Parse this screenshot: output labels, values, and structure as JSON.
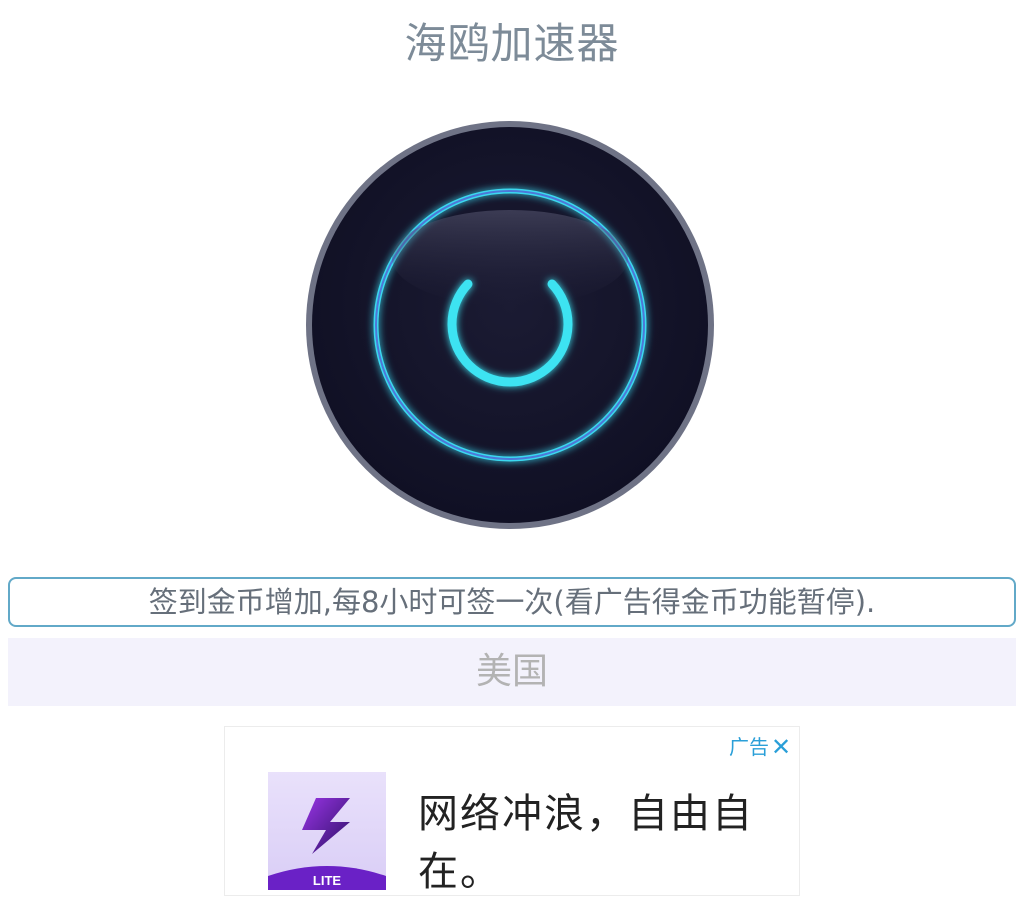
{
  "app": {
    "title": "海鸥加速器"
  },
  "power_button": {
    "icon": "power-icon",
    "state": "off",
    "colors": {
      "face": "#141428",
      "rim": "#6f7386",
      "glow": "#3ee3f2"
    }
  },
  "notice": {
    "text": "签到金币增加,每8小时可签一次(看广告得金币功能暂停)."
  },
  "region": {
    "selected": "美国"
  },
  "ad": {
    "label": "广告",
    "close_icon": "close-icon",
    "app_logo_icon": "lightning-bolt-icon",
    "app_logo_badge": "LITE",
    "headline": "网络冲浪，自由自在。",
    "accent": "#2a9fd8"
  }
}
